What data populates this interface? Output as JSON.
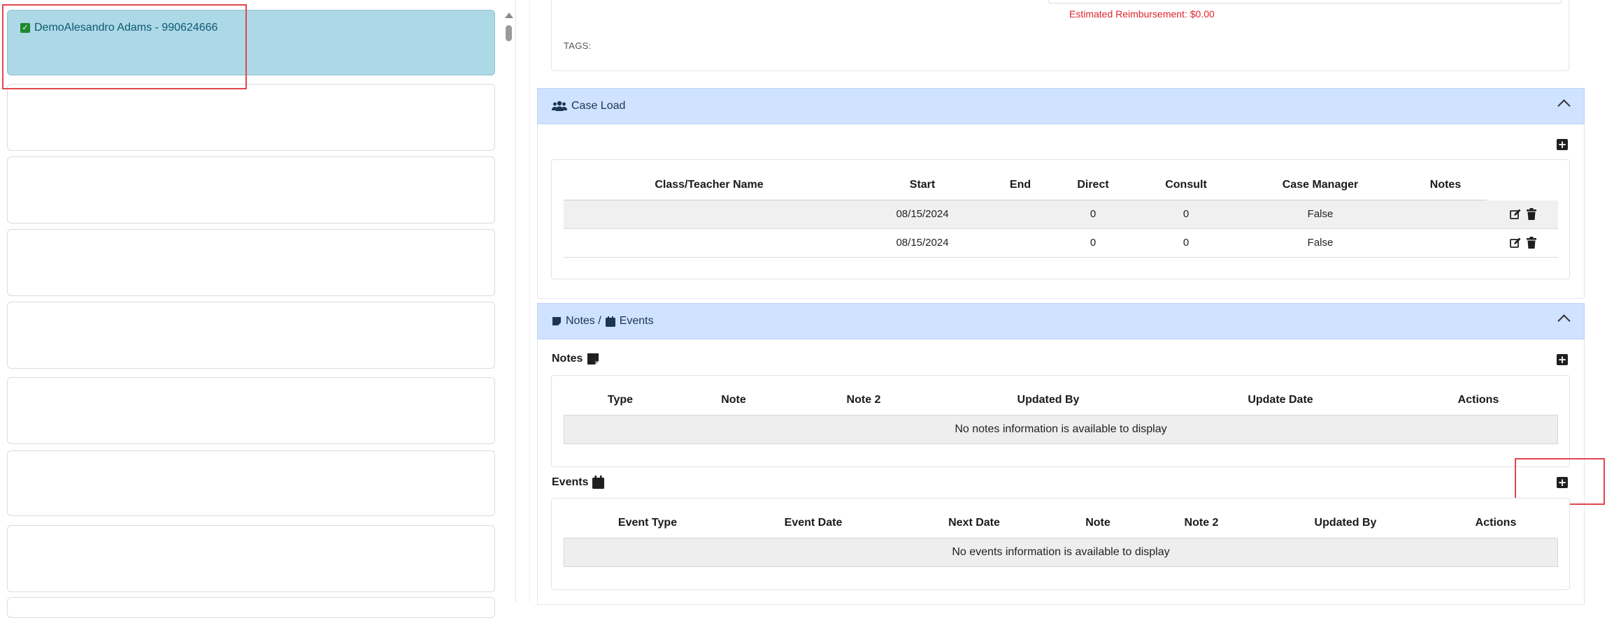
{
  "student_list": {
    "selected_student": "DemoAlesandro Adams - 990624666"
  },
  "details": {
    "estimated_reimbursement": "Estimated Reimbursement: $0.00",
    "tags_label": "TAGS:"
  },
  "case_load": {
    "header": "Case Load",
    "columns": [
      "Class/Teacher Name",
      "Start",
      "End",
      "Direct",
      "Consult",
      "Case Manager",
      "Notes"
    ],
    "rows": [
      {
        "class_teacher": "",
        "start": "08/15/2024",
        "end": "",
        "direct": "0",
        "consult": "0",
        "case_manager": "False",
        "notes": ""
      },
      {
        "class_teacher": "",
        "start": "08/15/2024",
        "end": "",
        "direct": "0",
        "consult": "0",
        "case_manager": "False",
        "notes": ""
      }
    ]
  },
  "notes_events": {
    "header_notes": "Notes /",
    "header_events": "Events",
    "notes": {
      "title": "Notes",
      "columns": [
        "Type",
        "Note",
        "Note 2",
        "Updated By",
        "Update Date",
        "Actions"
      ],
      "empty_message": "No notes information is available to display"
    },
    "events": {
      "title": "Events",
      "columns": [
        "Event Type",
        "Event Date",
        "Next Date",
        "Note",
        "Note 2",
        "Updated By",
        "Actions"
      ],
      "empty_message": "No events information is available to display"
    }
  },
  "colors": {
    "accent_header": "#cfe2ff",
    "selected_card": "#add8e6",
    "warning_text": "#e0242b",
    "annotation": "#e0474c"
  }
}
